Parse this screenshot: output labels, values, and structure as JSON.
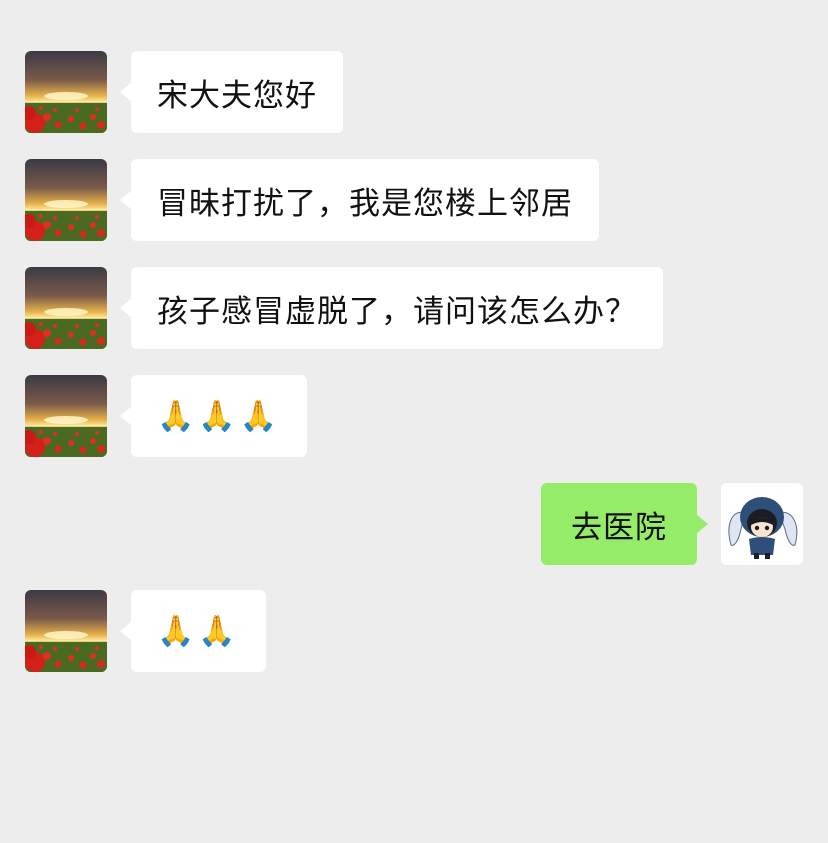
{
  "colors": {
    "background": "#ededed",
    "incoming_bubble": "#ffffff",
    "outgoing_bubble": "#95ec69"
  },
  "messages": [
    {
      "side": "incoming",
      "avatar": "sunset-poppy-field-avatar",
      "text": "宋大夫您好"
    },
    {
      "side": "incoming",
      "avatar": "sunset-poppy-field-avatar",
      "text": "冒昧打扰了，我是您楼上邻居"
    },
    {
      "side": "incoming",
      "avatar": "sunset-poppy-field-avatar",
      "text": "孩子感冒虚脱了，请问该怎么办？"
    },
    {
      "side": "incoming",
      "avatar": "sunset-poppy-field-avatar",
      "text": "🙏🙏🙏"
    },
    {
      "side": "outgoing",
      "avatar": "anime-girl-bunny-hood-avatar",
      "text": "去医院"
    },
    {
      "side": "incoming",
      "avatar": "sunset-poppy-field-avatar",
      "text": "🙏🙏"
    }
  ]
}
